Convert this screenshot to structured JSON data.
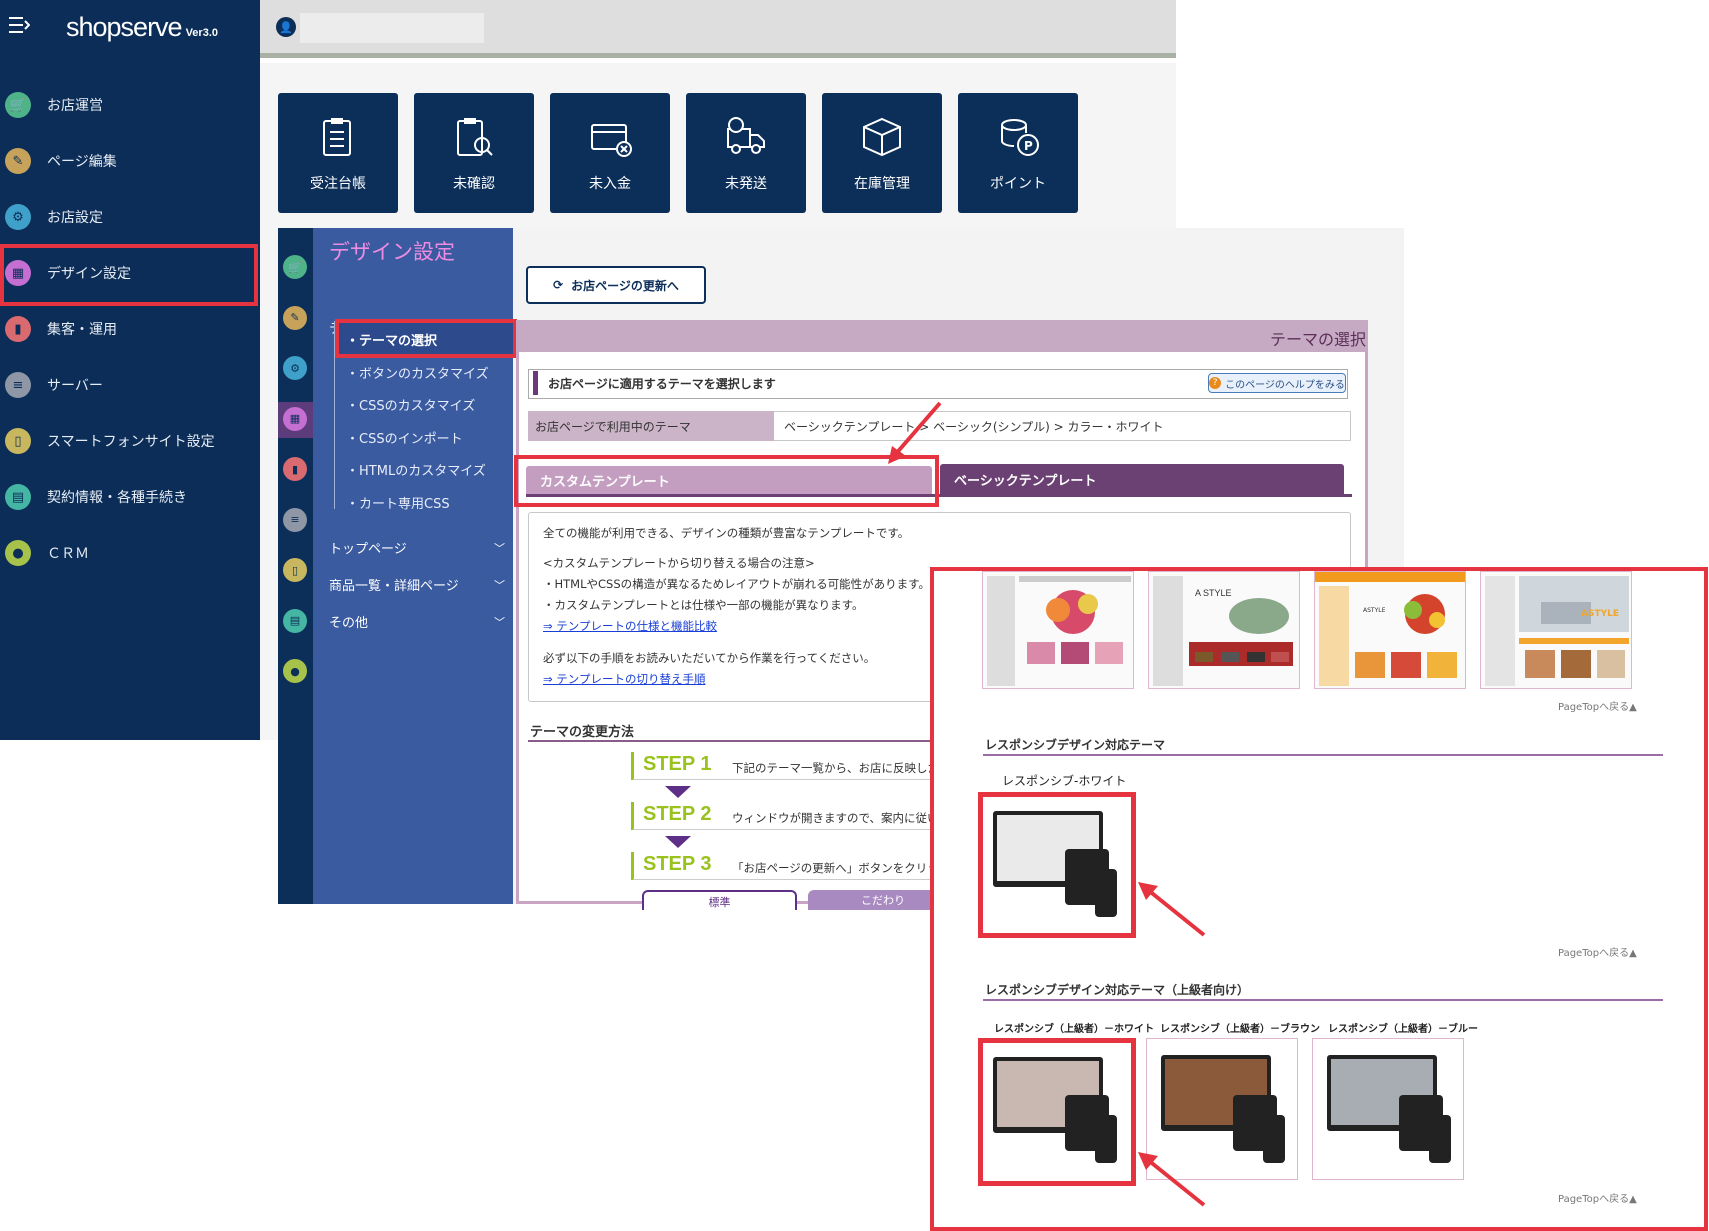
{
  "brand": {
    "name": "shopserve",
    "version": "Ver3.0"
  },
  "sidebar": {
    "items": [
      {
        "label": "お店運営",
        "icon": "cart-icon",
        "color": "#4fb38a"
      },
      {
        "label": "ページ編集",
        "icon": "edit-icon",
        "color": "#c7a25a"
      },
      {
        "label": "お店設定",
        "icon": "gear-icon",
        "color": "#3fa1c9"
      },
      {
        "label": "デザイン設定",
        "icon": "layout-icon",
        "color": "#c56fd3"
      },
      {
        "label": "集客・運用",
        "icon": "chart-icon",
        "color": "#d96a6f"
      },
      {
        "label": "サーバー",
        "icon": "server-icon",
        "color": "#8f97a6"
      },
      {
        "label": "スマートフォンサイト設定",
        "icon": "smartphone-icon",
        "color": "#c9b760"
      },
      {
        "label": "契約情報・各種手続き",
        "icon": "clipboard-icon",
        "color": "#45b6a4"
      },
      {
        "label": "ＣＲＭ",
        "icon": "users-icon",
        "color": "#a7c24a"
      }
    ]
  },
  "tiles": [
    {
      "label": "受注台帳",
      "icon": "order-ledger-icon"
    },
    {
      "label": "未確認",
      "icon": "unconfirmed-search-icon"
    },
    {
      "label": "未入金",
      "icon": "unpaid-card-icon"
    },
    {
      "label": "未発送",
      "icon": "unshipped-truck-icon"
    },
    {
      "label": "在庫管理",
      "icon": "inventory-box-icon"
    },
    {
      "label": "ポイント",
      "icon": "points-coins-icon"
    }
  ],
  "design_nav": {
    "title": "デザイン設定",
    "theme_section": "テーマ",
    "theme_items": [
      "テーマの選択",
      "ボタンのカスタマイズ",
      "CSSのカスタマイズ",
      "CSSのインポート",
      "HTMLのカスタマイズ",
      "カート専用CSS"
    ],
    "sections": [
      "トップページ",
      "商品一覧・詳細ページ",
      "その他"
    ]
  },
  "main": {
    "update_button": "お店ページの更新へ",
    "panel_title": "テーマの選択",
    "subheading": "お店ページに適用するテーマを選択します",
    "help_button": "このページのヘルプをみる",
    "current_theme_label": "お店ページで利用中のテーマ",
    "current_theme_value": "ベーシックテンプレート > ベーシック(シンプル) > カラー・ホワイト",
    "tabs": [
      "カスタムテンプレート",
      "ベーシックテンプレート"
    ],
    "description": {
      "line1": "全ての機能が利用できる、デザインの種類が豊富なテンプレートです。",
      "line2": "<カスタムテンプレートから切り替える場合の注意>",
      "line3": "・HTMLやCSSの構造が異なるためレイアウトが崩れる可能性があります。",
      "line4": "・カスタムテンプレートとは仕様や一部の機能が異なります。",
      "link1": "⇒ テンプレートの仕様と機能比較",
      "line5": "必ず以下の手順をお読みいただいてから作業を行ってください。",
      "link2": "⇒ テンプレートの切り替え手順"
    },
    "change_title": "テーマの変更方法",
    "steps": [
      {
        "label": "STEP 1",
        "text": "下記のテーマ一覧から、お店に反映した"
      },
      {
        "label": "STEP 2",
        "text": "ウィンドウが開きますので、案内に従いう"
      },
      {
        "label": "STEP 3",
        "text": "「お店ページの更新へ」ボタンをクリックし"
      }
    ],
    "mode_buttons": [
      "標準",
      "こだわり"
    ]
  },
  "zoom": {
    "thumb_labels": [
      "A STYLE",
      "ASTYLE",
      "ASTYLE"
    ],
    "pagetop": "PageTopへ戻る▲",
    "responsive_title": "レスポンシブデザイン対応テーマ",
    "responsive_item": "レスポンシブ-ホワイト",
    "advanced_title": "レスポンシブデザイン対応テーマ（上級者向け）",
    "advanced_items": [
      "レスポンシブ（上級者）－ホワイト",
      "レスポンシブ（上級者）－ブラウン",
      "レスポンシブ（上級者）－ブルー"
    ]
  },
  "colors": {
    "sidebar": "#0b2d57",
    "highlight": "#e5343f",
    "tile": "#0c2f59",
    "nav": "#3a5ba0",
    "accent_purple": "#6b4173",
    "step_green": "#9ac21f"
  }
}
